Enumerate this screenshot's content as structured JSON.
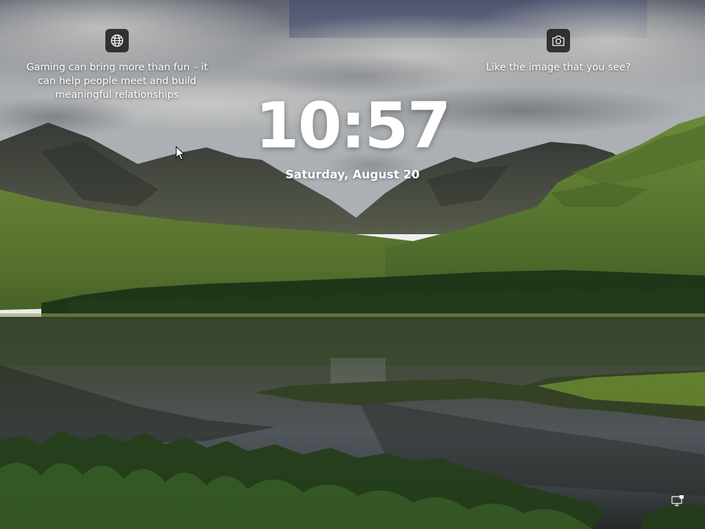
{
  "lockscreen": {
    "time": "10:57",
    "date": "Saturday, August 20"
  },
  "widgets": {
    "left": {
      "icon": "globe-icon",
      "text_lines": [
        "Gaming can bring more than fun – it",
        "can help people meet and build",
        "meaningful relationships"
      ]
    },
    "right": {
      "icon": "camera-icon",
      "text": "Like the image that you see?"
    }
  },
  "system_tray": {
    "network_icon": "network-icon"
  },
  "colors": {
    "widget_bg": "#202020",
    "text": "#ffffff"
  }
}
